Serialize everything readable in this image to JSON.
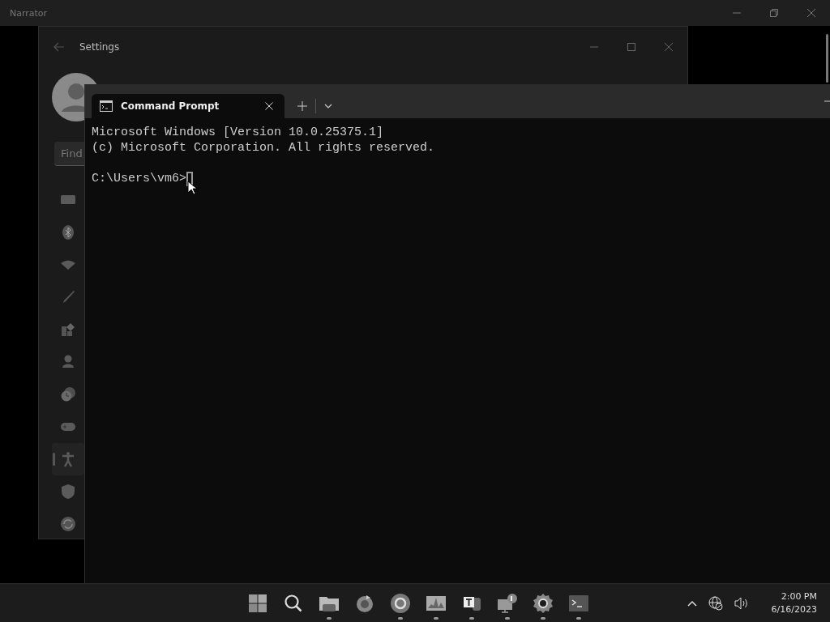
{
  "narrator_window": {
    "title": "Narrator"
  },
  "settings_window": {
    "title": "Settings",
    "search": {
      "placeholder": "Find"
    },
    "nav_items": [
      {
        "selected": false
      },
      {
        "selected": false
      },
      {
        "selected": false
      },
      {
        "selected": false
      },
      {
        "selected": false
      },
      {
        "selected": false
      },
      {
        "selected": false
      },
      {
        "selected": false
      },
      {
        "selected": true
      },
      {
        "selected": false
      },
      {
        "selected": false
      }
    ]
  },
  "terminal": {
    "tabs": [
      {
        "title": "Command Prompt",
        "selected": true
      }
    ],
    "output": [
      "Microsoft Windows [Version 10.0.25375.1]",
      "(c) Microsoft Corporation. All rights reserved."
    ],
    "prompt": "C:\\Users\\vm6>"
  },
  "taskbar": {
    "apps": [
      {
        "running": false
      },
      {
        "running": false
      },
      {
        "running": true
      },
      {
        "running": false
      },
      {
        "running": true
      },
      {
        "running": true
      },
      {
        "running": true
      },
      {
        "running": true
      },
      {
        "running": true
      },
      {
        "running": true
      }
    ],
    "clock": {
      "time": "2:00 PM",
      "date": "6/16/2023"
    }
  }
}
